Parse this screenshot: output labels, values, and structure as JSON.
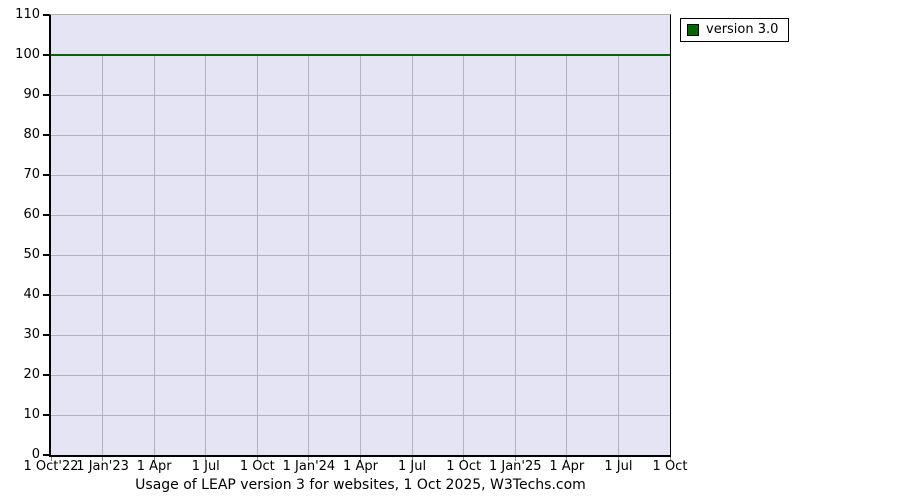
{
  "page": {
    "background": "#ffffff"
  },
  "chart_data": {
    "type": "line",
    "title": "Usage of LEAP version 3 for websites, 1 Oct 2025, W3Techs.com",
    "xlabel": "",
    "ylabel": "",
    "x_tick_labels": [
      "1 Oct'22",
      "1 Jan'23",
      "1 Apr",
      "1 Jul",
      "1 Oct",
      "1 Jan'24",
      "1 Apr",
      "1 Jul",
      "1 Oct",
      "1 Jan'25",
      "1 Apr",
      "1 Jul",
      "1 Oct"
    ],
    "y_ticks": [
      0,
      10,
      20,
      30,
      40,
      50,
      60,
      70,
      80,
      90,
      100,
      110
    ],
    "ylim": [
      0,
      110
    ],
    "grid": true,
    "legend_position": "outside-top-right",
    "series": [
      {
        "name": "version 3.0",
        "color": "#006600",
        "values": [
          100,
          100,
          100,
          100,
          100,
          100,
          100,
          100,
          100,
          100,
          100,
          100,
          100
        ]
      }
    ],
    "colors": {
      "plot_background": "#e4e4f4",
      "gridline": "#b3b3bd",
      "axis": "#000000",
      "plot_top_border": "#b0b0b0",
      "x_tick_mark": "#888888",
      "legend_border": "#000000",
      "legend_background": "#ffffff",
      "text": "#000000"
    }
  }
}
